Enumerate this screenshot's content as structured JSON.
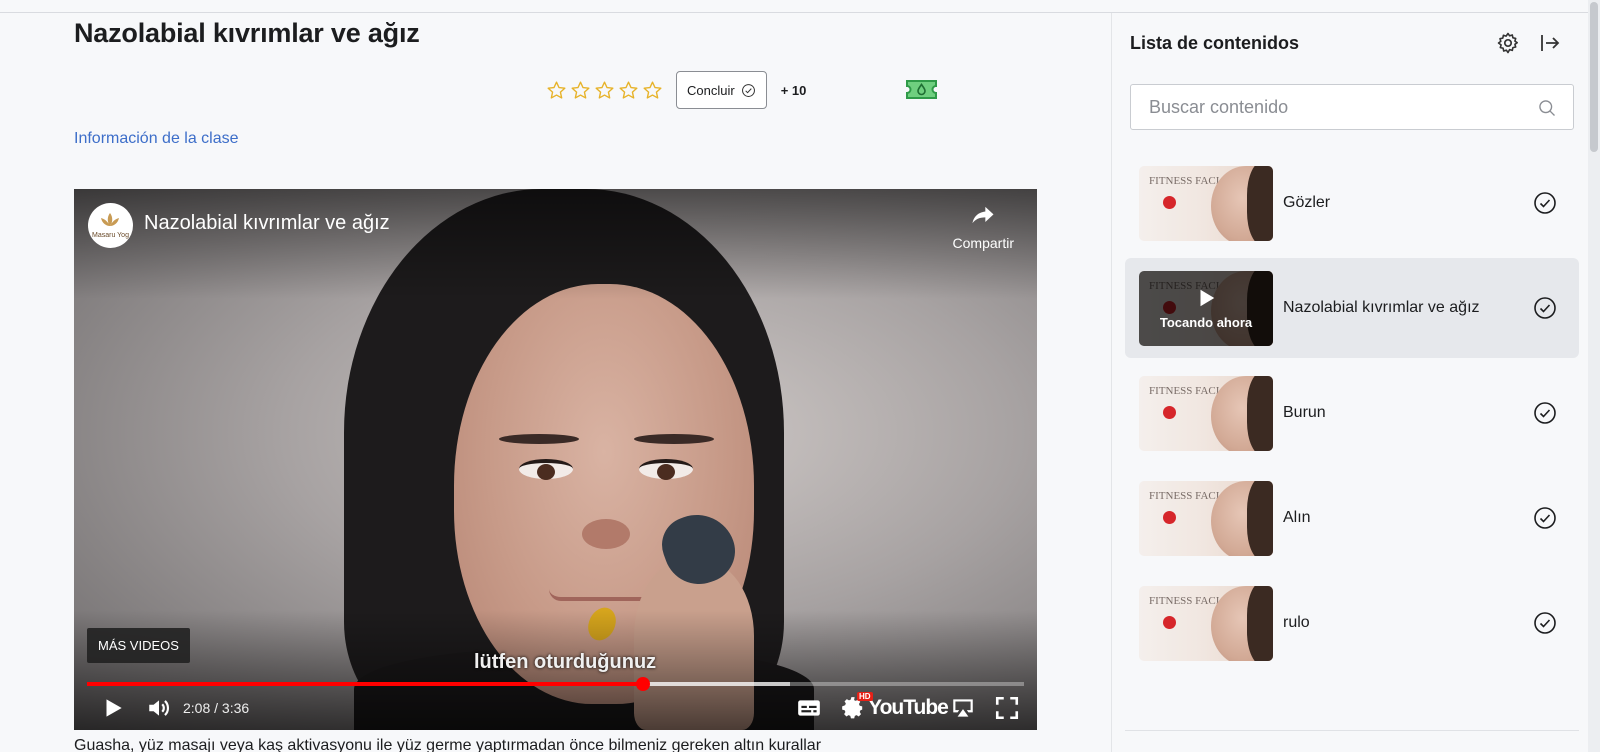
{
  "lesson": {
    "title": "Nazolabial kıvrımlar ve ağız",
    "rating": {
      "max": 5,
      "value": 0
    },
    "complete_label": "Concluir",
    "points": "+ 10",
    "info_link": "Información de la clase",
    "description": "Guasha, yüz masajı veya kaş aktivasyonu ile yüz germe yaptırmadan önce bilmeniz gereken altın kurallar"
  },
  "video": {
    "title": "Nazolabial kıvrımlar ve ağız",
    "share_label": "Compartir",
    "more_videos_label": "MÁS VIDEOS",
    "caption": "lütfen oturduğunuz",
    "time": "2:08 / 3:36",
    "played_fraction": 0.593,
    "loaded_fraction": 0.75,
    "youtube_label": "YouTube",
    "hd_badge": "HD",
    "channel_logo_text": "Masaru Yog"
  },
  "sidebar": {
    "title": "Lista de contenidos",
    "search_placeholder": "Buscar contenido",
    "thumb_text": "FITNESS FACIAL",
    "now_playing_label": "Tocando ahora",
    "items": [
      {
        "label": "Gözler",
        "active": false,
        "completed": true
      },
      {
        "label": "Nazolabial kıvrımlar ve ağız",
        "active": true,
        "completed": true
      },
      {
        "label": "Burun",
        "active": false,
        "completed": true
      },
      {
        "label": "Alın",
        "active": false,
        "completed": true
      },
      {
        "label": "rulo",
        "active": false,
        "completed": true
      }
    ]
  },
  "colors": {
    "accent_link": "#3d6ec9",
    "star": "#e7b32a",
    "progress_played": "#ff0000",
    "ticket": "#3fae5a",
    "active_item_bg": "#e6e8ec"
  }
}
